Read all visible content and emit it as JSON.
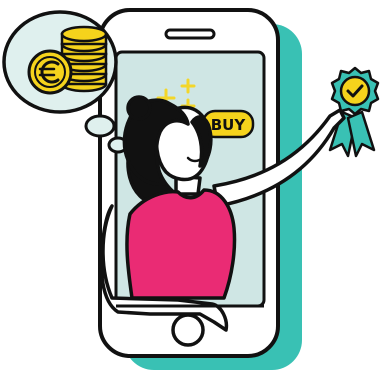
{
  "illustration": {
    "badge_text": "BUY",
    "colors": {
      "ink": "#111111",
      "phone_screen": "#cfe6e4",
      "phone_shadow": "#39c1b4",
      "coin_yellow": "#f5d31c",
      "accent_pink": "#ea2b74",
      "sparkle_yellow": "#f3d629",
      "bubble_fill": "#dff0ee",
      "paper": "#ffffff"
    },
    "icons": [
      "coin-stack-icon",
      "euro-coin-icon",
      "sparkle-icon",
      "award-badge-icon",
      "checkmark-icon",
      "home-button-icon"
    ]
  }
}
